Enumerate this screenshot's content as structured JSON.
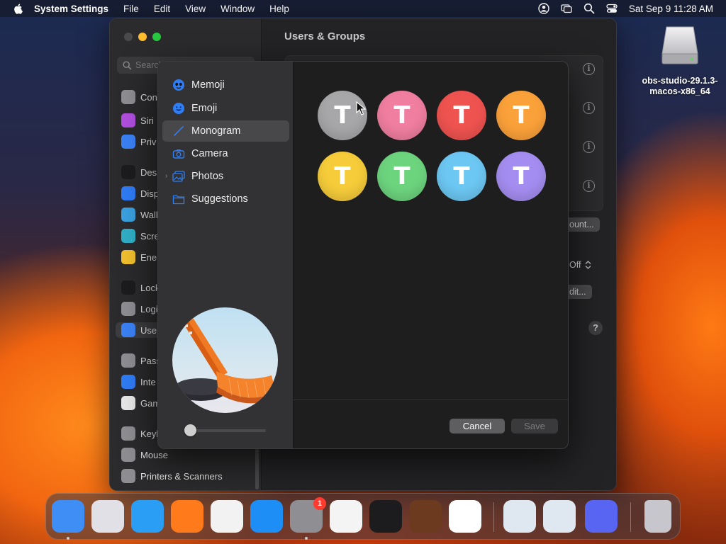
{
  "menubar": {
    "app_name": "System Settings",
    "menus": [
      "File",
      "Edit",
      "View",
      "Window",
      "Help"
    ],
    "clock": "Sat Sep 9  11:28 AM"
  },
  "desktop": {
    "drive_label": "obs-studio-29.1.3-macos-x86_64"
  },
  "settings": {
    "search_placeholder": "Search",
    "title": "Users & Groups",
    "sidebar": [
      {
        "label": "Con",
        "color": "#8e8e93"
      },
      {
        "label": "Siri",
        "color": "#b14fe0"
      },
      {
        "label": "Priv",
        "color": "#3b82f6"
      },
      {
        "label": "Des",
        "color": "#1c1c1e"
      },
      {
        "label": "Disp",
        "color": "#2f7cf6"
      },
      {
        "label": "Wall",
        "color": "#3aa1e0"
      },
      {
        "label": "Scre",
        "color": "#30b0c7"
      },
      {
        "label": "Ene",
        "color": "#f2c02e"
      },
      {
        "label": "Lock",
        "color": "#1c1c1e"
      },
      {
        "label": "Logi",
        "color": "#8e8e93"
      },
      {
        "label": "Use",
        "color": "#3b82f6"
      },
      {
        "label": "Pass",
        "color": "#8e8e93"
      },
      {
        "label": "Inte",
        "color": "#2f7cf6"
      },
      {
        "label": "Gam",
        "color": "#e8e8e8"
      },
      {
        "label": "Keyb",
        "color": "#8e8e93"
      },
      {
        "label": "Mouse",
        "color": "#8e8e93"
      },
      {
        "label": "Printers & Scanners",
        "color": "#8e8e93"
      }
    ],
    "add_account_label": "ount...",
    "off_label": "Off",
    "edit_label": "dit..."
  },
  "dialog": {
    "categories": [
      {
        "label": "Memoji",
        "icon": "memoji-icon"
      },
      {
        "label": "Emoji",
        "icon": "emoji-icon"
      },
      {
        "label": "Monogram",
        "icon": "pencil-icon"
      },
      {
        "label": "Camera",
        "icon": "camera-icon"
      },
      {
        "label": "Photos",
        "icon": "photos-icon"
      },
      {
        "label": "Suggestions",
        "icon": "folder-icon"
      }
    ],
    "selected_category": "Monogram",
    "monogram_letter": "T",
    "monogram_colors": [
      "#a7a7a9",
      "#f07ea0",
      "#ef5350",
      "#fba13a",
      "#f6cc3a",
      "#6dd47e",
      "#6cc7f2",
      "#a48df0"
    ],
    "zoom_level": 0.0,
    "cancel_label": "Cancel",
    "save_label": "Save"
  },
  "dock": {
    "apps": [
      {
        "name": "finder",
        "color": "#3f8ef5"
      },
      {
        "name": "launchpad",
        "color": "#e0e0e6"
      },
      {
        "name": "safari",
        "color": "#2a9df4"
      },
      {
        "name": "firefox",
        "color": "#ff7a1a"
      },
      {
        "name": "chrome",
        "color": "#f2f2f2"
      },
      {
        "name": "app-store",
        "color": "#1e8ef7"
      },
      {
        "name": "system-settings",
        "color": "#8e8e93"
      },
      {
        "name": "textedit",
        "color": "#f4f4f4"
      },
      {
        "name": "terminal",
        "color": "#1c1c1e"
      },
      {
        "name": "garageband",
        "color": "#6b3a1f"
      },
      {
        "name": "vscode",
        "color": "#ffffff"
      },
      {
        "name": "virtualbox-vm",
        "color": "#dfe7f1"
      },
      {
        "name": "virtualbox",
        "color": "#dfe7f1"
      },
      {
        "name": "discord",
        "color": "#5865f2"
      },
      {
        "name": "trash",
        "color": "#c6c6cc"
      }
    ],
    "settings_badge": "1"
  }
}
